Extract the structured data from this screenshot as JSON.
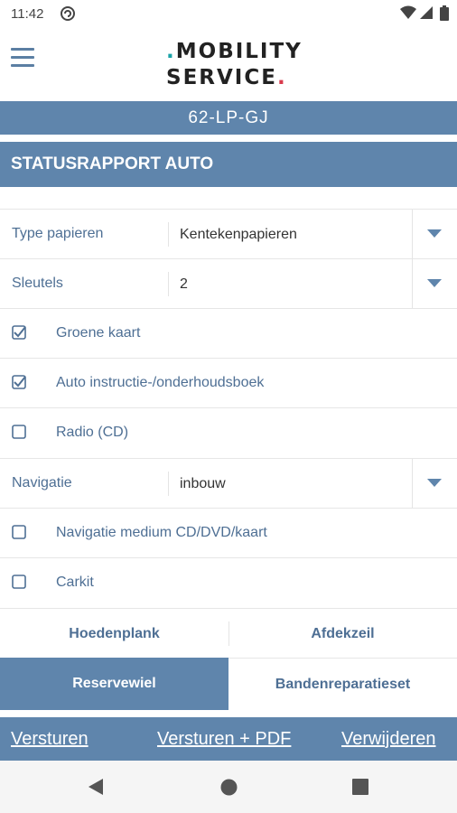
{
  "status_bar": {
    "time": "11:42"
  },
  "app": {
    "logo_line1": "MOBILITY",
    "logo_line2": "SERVICE",
    "plate": "62-LP-GJ",
    "section_title": "STATUSRAPPORT AUTO"
  },
  "fields": {
    "type_papieren": {
      "label": "Type papieren",
      "value": "Kentekenpapieren"
    },
    "sleutels": {
      "label": "Sleutels",
      "value": "2"
    },
    "navigatie": {
      "label": "Navigatie",
      "value": "inbouw"
    }
  },
  "checkboxes": [
    {
      "label": "Groene kaart",
      "checked": true
    },
    {
      "label": "Auto instructie-/onderhoudsboek",
      "checked": true
    },
    {
      "label": "Radio (CD)",
      "checked": false
    },
    {
      "label": "Navigatie medium CD/DVD/kaart",
      "checked": false
    },
    {
      "label": "Carkit",
      "checked": false
    }
  ],
  "toggles": {
    "hoedenplank": "Hoedenplank",
    "afdekzeil": "Afdekzeil"
  },
  "segment": {
    "selected": "Reservewiel",
    "other": "Bandenreparatieset"
  },
  "actions": {
    "send": "Versturen",
    "send_pdf": "Versturen + PDF",
    "delete": "Verwijderen"
  },
  "colors": {
    "primary": "#5f85ac",
    "label": "#4e6f94",
    "logo_teal": "#1aa3a8",
    "logo_red": "#d83a4c"
  }
}
